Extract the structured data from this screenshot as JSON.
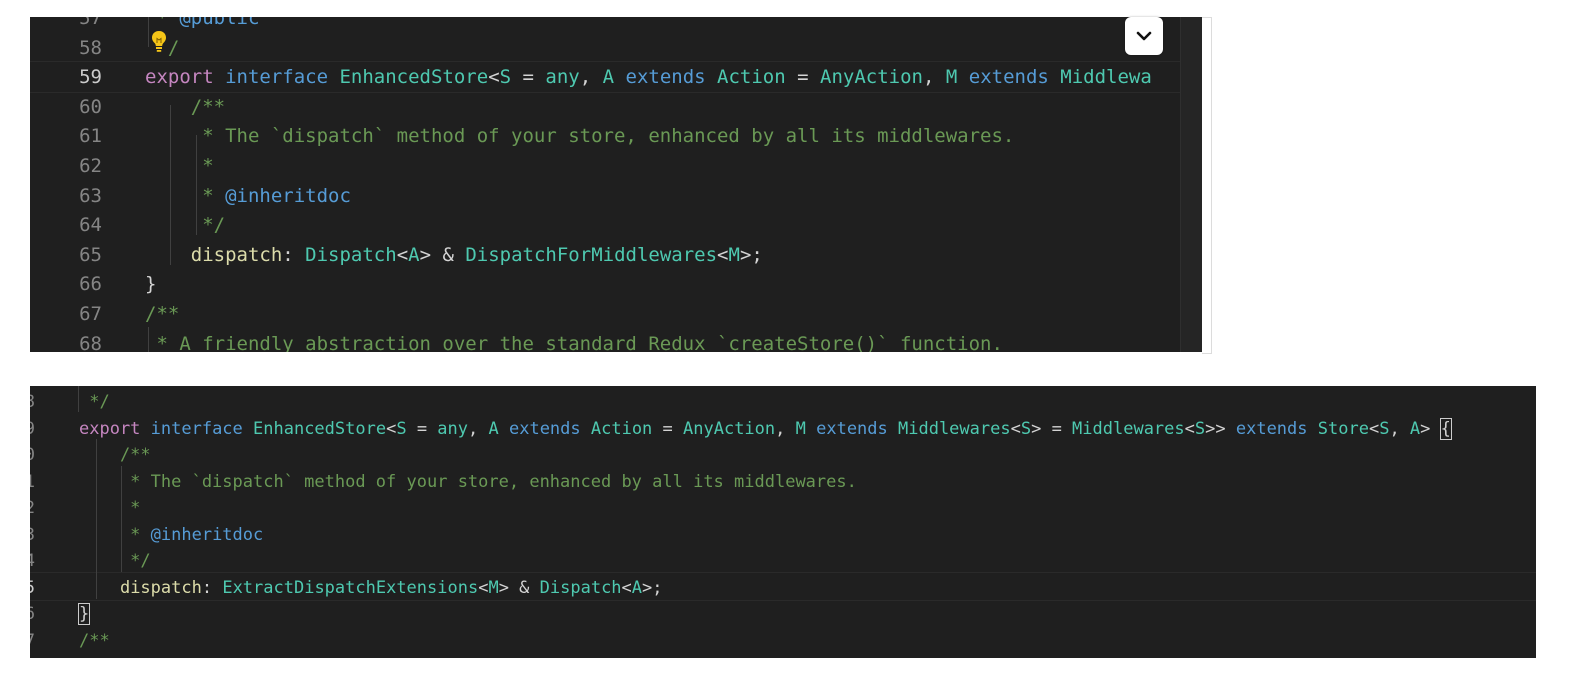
{
  "top_editor": {
    "lines": [
      {
        "num": "57",
        "tokens": [
          [
            "cm",
            " * "
          ],
          [
            "tag",
            "@public"
          ]
        ]
      },
      {
        "num": "58",
        "tokens": [
          [
            "cm",
            "  /"
          ]
        ]
      },
      {
        "num": "59",
        "tokens": [
          [
            "kw",
            "export "
          ],
          [
            "st",
            "interface "
          ],
          [
            "ty",
            "EnhancedStore"
          ],
          [
            "pl",
            "<"
          ],
          [
            "tp",
            "S"
          ],
          [
            "pl",
            " = "
          ],
          [
            "ty",
            "any"
          ],
          [
            "pl",
            ", "
          ],
          [
            "tp",
            "A"
          ],
          [
            "st",
            " extends "
          ],
          [
            "ty",
            "Action"
          ],
          [
            "pl",
            " = "
          ],
          [
            "ty",
            "AnyAction"
          ],
          [
            "pl",
            ", "
          ],
          [
            "tp",
            "M"
          ],
          [
            "st",
            " extends "
          ],
          [
            "ty",
            "Middlewa"
          ]
        ]
      },
      {
        "num": "60",
        "tokens": [
          [
            "cm",
            "    /**"
          ]
        ]
      },
      {
        "num": "61",
        "tokens": [
          [
            "cm",
            "     * The `dispatch` method of your store, enhanced by all its middlewares."
          ]
        ]
      },
      {
        "num": "62",
        "tokens": [
          [
            "cm",
            "     *"
          ]
        ]
      },
      {
        "num": "63",
        "tokens": [
          [
            "cm",
            "     * "
          ],
          [
            "tag",
            "@inheritdoc"
          ]
        ]
      },
      {
        "num": "64",
        "tokens": [
          [
            "cm",
            "     */"
          ]
        ]
      },
      {
        "num": "65",
        "tokens": [
          [
            "pl",
            "    "
          ],
          [
            "pr",
            "dispatch"
          ],
          [
            "pl",
            ": "
          ],
          [
            "ty",
            "Dispatch"
          ],
          [
            "pl",
            "<"
          ],
          [
            "tp",
            "A"
          ],
          [
            "pl",
            "> & "
          ],
          [
            "ty",
            "DispatchForMiddlewares"
          ],
          [
            "pl",
            "<"
          ],
          [
            "tp",
            "M"
          ],
          [
            "pl",
            ">;"
          ]
        ]
      },
      {
        "num": "66",
        "tokens": [
          [
            "pl",
            "}"
          ]
        ]
      },
      {
        "num": "67",
        "tokens": [
          [
            "cm",
            "/**"
          ]
        ]
      },
      {
        "num": "68",
        "tokens": [
          [
            "cm",
            " * A friendly abstraction over the standard Redux `createStore()` function."
          ]
        ]
      }
    ],
    "active_line": "59"
  },
  "bottom_editor": {
    "lines": [
      {
        "num": "8",
        "tokens": [
          [
            "cm",
            " */"
          ]
        ]
      },
      {
        "num": "9",
        "tokens": [
          [
            "kw",
            "export "
          ],
          [
            "st",
            "interface "
          ],
          [
            "ty",
            "EnhancedStore"
          ],
          [
            "pl",
            "<"
          ],
          [
            "tp",
            "S"
          ],
          [
            "pl",
            " = "
          ],
          [
            "ty",
            "any"
          ],
          [
            "pl",
            ", "
          ],
          [
            "tp",
            "A"
          ],
          [
            "st",
            " extends "
          ],
          [
            "ty",
            "Action"
          ],
          [
            "pl",
            " = "
          ],
          [
            "ty",
            "AnyAction"
          ],
          [
            "pl",
            ", "
          ],
          [
            "tp",
            "M"
          ],
          [
            "st",
            " extends "
          ],
          [
            "ty",
            "Middlewares"
          ],
          [
            "pl",
            "<"
          ],
          [
            "tp",
            "S"
          ],
          [
            "pl",
            "> = "
          ],
          [
            "ty",
            "Middlewares"
          ],
          [
            "pl",
            "<"
          ],
          [
            "tp",
            "S"
          ],
          [
            "pl",
            ">> "
          ],
          [
            "st",
            "extends "
          ],
          [
            "ty",
            "Store"
          ],
          [
            "pl",
            "<"
          ],
          [
            "tp",
            "S"
          ],
          [
            "pl",
            ", "
          ],
          [
            "tp",
            "A"
          ],
          [
            "pl",
            "> "
          ],
          [
            "pl",
            "{"
          ]
        ]
      },
      {
        "num": "0",
        "tokens": [
          [
            "cm",
            "    /**"
          ]
        ]
      },
      {
        "num": "1",
        "tokens": [
          [
            "cm",
            "     * The `dispatch` method of your store, enhanced by all its middlewares."
          ]
        ]
      },
      {
        "num": "2",
        "tokens": [
          [
            "cm",
            "     *"
          ]
        ]
      },
      {
        "num": "3",
        "tokens": [
          [
            "cm",
            "     * "
          ],
          [
            "tag",
            "@inheritdoc"
          ]
        ]
      },
      {
        "num": "4",
        "tokens": [
          [
            "cm",
            "     */"
          ]
        ]
      },
      {
        "num": "5",
        "tokens": [
          [
            "pl",
            "    "
          ],
          [
            "pr",
            "dispatch"
          ],
          [
            "pl",
            ": "
          ],
          [
            "ty",
            "ExtractDispatchExtensions"
          ],
          [
            "pl",
            "<"
          ],
          [
            "tp",
            "M"
          ],
          [
            "pl",
            "> & "
          ],
          [
            "ty",
            "Dispatch"
          ],
          [
            "pl",
            "<"
          ],
          [
            "tp",
            "A"
          ],
          [
            "pl",
            ">;"
          ]
        ]
      },
      {
        "num": "6",
        "tokens": [
          [
            "pl",
            "}"
          ]
        ]
      },
      {
        "num": "7",
        "tokens": [
          [
            "cm",
            "/**"
          ]
        ]
      }
    ],
    "active_line": "5"
  },
  "icons": {
    "lightbulb": "lightbulb-icon",
    "fold": "chevron-down-icon"
  },
  "colors": {
    "background": "#1f1f1f",
    "keyword": "#c586c0",
    "storage": "#569cd6",
    "type": "#4ec9b0",
    "property": "#dcdcaa",
    "comment": "#6a9955",
    "lightbulb": "#f5c518"
  }
}
